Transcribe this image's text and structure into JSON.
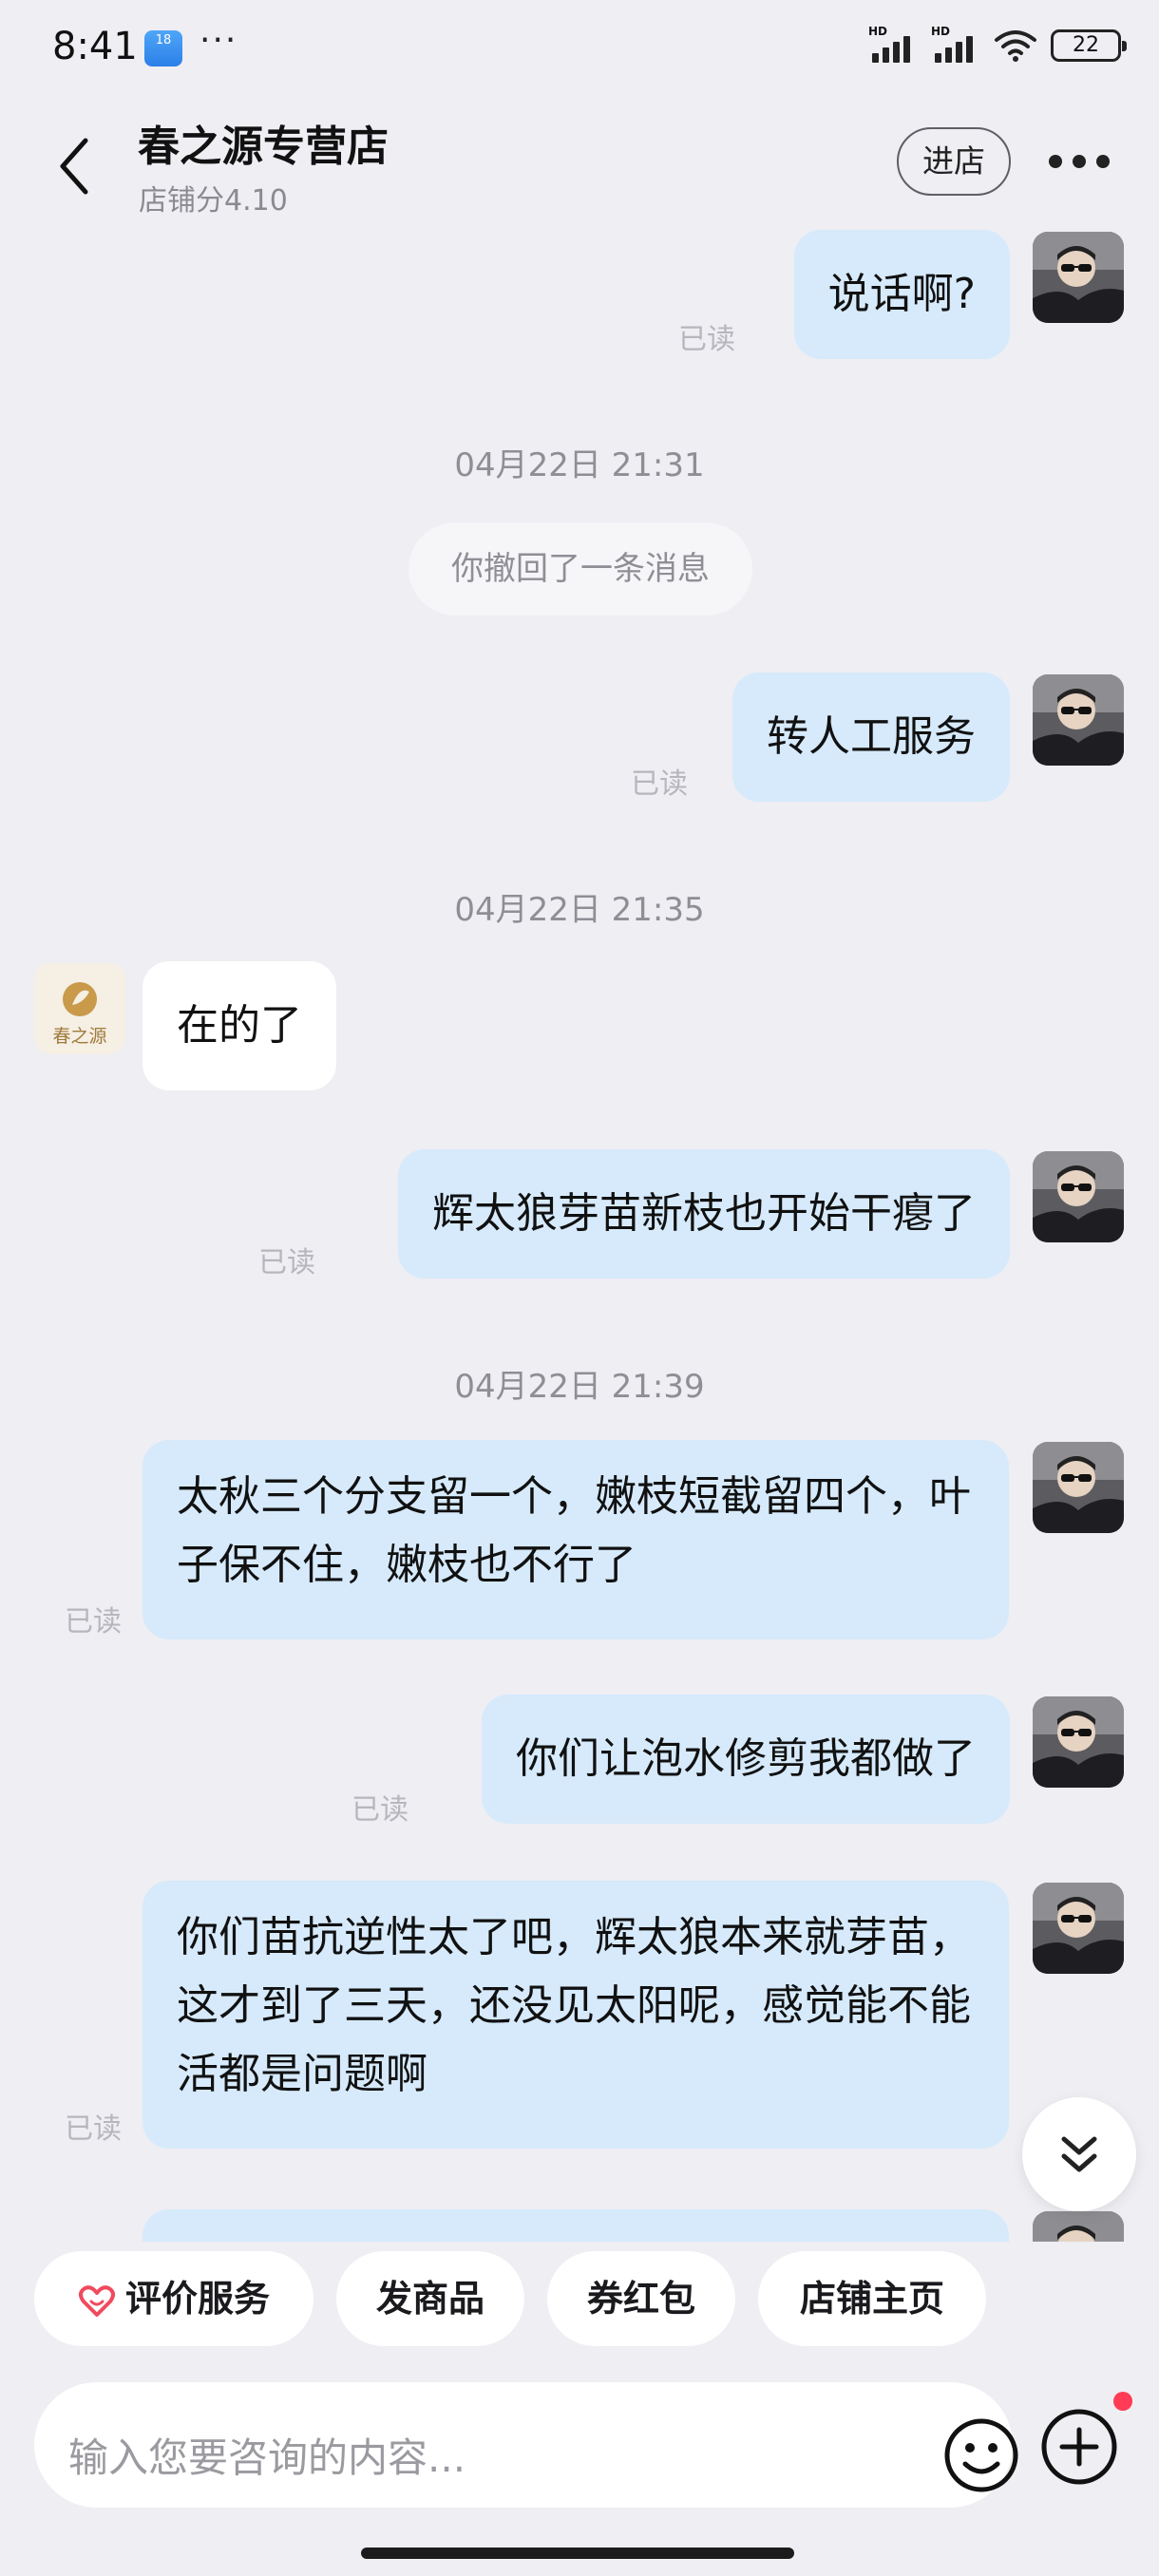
{
  "status_bar": {
    "time": "8:41",
    "weather_badge": "18",
    "more_dots": "···",
    "signal_labels": [
      "HD",
      "HD"
    ],
    "battery": "22",
    "icons": [
      "weather-icon",
      "signal-icon",
      "wifi-icon",
      "battery-icon"
    ]
  },
  "header": {
    "title": "春之源专营店",
    "score": "店铺分4.10",
    "enter_label": "进店",
    "icons": [
      "back-icon",
      "more-icon"
    ]
  },
  "messages": {
    "m1": {
      "text": "说话啊?",
      "read": "已读",
      "side": "outgoing"
    },
    "sep1": "04月22日 21:31",
    "recall": "你撤回了一条消息",
    "m2": {
      "text": "转人工服务",
      "read": "已读",
      "side": "outgoing"
    },
    "sep2": "04月22日 21:35",
    "m3": {
      "text": "在的了",
      "side": "incoming"
    },
    "shop_avatar_text": "春之源",
    "m4": {
      "text": "辉太狼芽苗新枝也开始干瘪了",
      "read": "已读",
      "side": "outgoing"
    },
    "sep3": "04月22日 21:39",
    "m5": {
      "text": "太秋三个分支留一个，嫩枝短截留四个，叶子保不住，嫩枝也不行了",
      "read": "已读",
      "side": "outgoing"
    },
    "m6": {
      "text": "你们让泡水修剪我都做了",
      "read": "已读",
      "side": "outgoing"
    },
    "m7": {
      "text": "你们苗抗逆性太了吧，辉太狼本来就芽苗，这才到了三天，还没见太阳呢，感觉能不能活都是问题啊",
      "read": "已读",
      "side": "outgoing"
    }
  },
  "shortcuts": [
    {
      "label": "评价服务",
      "icon": "heart-icon"
    },
    {
      "label": "发商品"
    },
    {
      "label": "券红包"
    },
    {
      "label": "店铺主页"
    }
  ],
  "input": {
    "placeholder": "输入您要咨询的内容..."
  },
  "colors": {
    "background": "#eeeef3",
    "outgoing_bubble": "#d6eafb",
    "incoming_bubble": "#ffffff",
    "notification_dot": "#ff3b55"
  }
}
